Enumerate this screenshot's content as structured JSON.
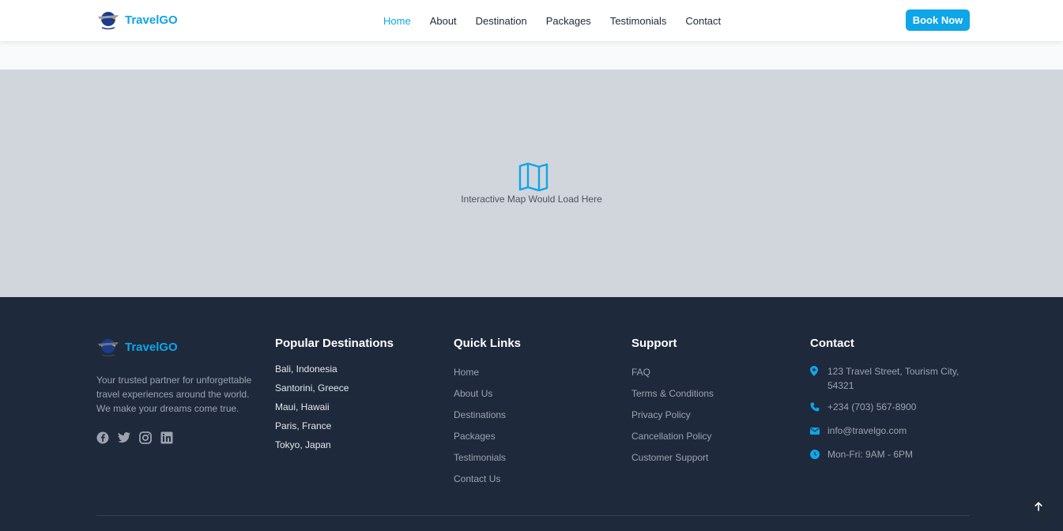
{
  "brand": {
    "name": "TravelGO",
    "logo_icon": "globe-plane-logo",
    "accent_color": "#0ea5e9"
  },
  "nav": {
    "items": [
      {
        "label": "Home",
        "active": true
      },
      {
        "label": "About"
      },
      {
        "label": "Destination"
      },
      {
        "label": "Packages"
      },
      {
        "label": "Testimonials"
      },
      {
        "label": "Contact"
      }
    ],
    "cta_label": "Book Now"
  },
  "map": {
    "icon": "map-icon",
    "placeholder_text": "Interactive Map Would Load Here"
  },
  "footer": {
    "brand_name": "TravelGO",
    "description": "Your trusted partner for unforgettable travel experiences around the world. We make your dreams come true.",
    "socials": [
      "facebook-icon",
      "twitter-icon",
      "instagram-icon",
      "linkedin-icon"
    ],
    "popular_destinations": {
      "title": "Popular Destinations",
      "items": [
        "Bali, Indonesia",
        "Santorini, Greece",
        "Maui, Hawaii",
        "Paris, France",
        "Tokyo, Japan"
      ]
    },
    "quick_links": {
      "title": "Quick Links",
      "items": [
        "Home",
        "About Us",
        "Destinations",
        "Packages",
        "Testimonials",
        "Contact Us"
      ]
    },
    "support": {
      "title": "Support",
      "items": [
        "FAQ",
        "Terms & Conditions",
        "Privacy Policy",
        "Cancellation Policy",
        "Customer Support"
      ]
    },
    "contact": {
      "title": "Contact",
      "address": "123 Travel Street, Tourism City, 54321",
      "phone": "+234 (703) 567-8900",
      "email": "info@travelgo.com",
      "hours": "Mon-Fri: 9AM - 6PM"
    },
    "back_to_top_icon": "arrow-up-icon"
  }
}
